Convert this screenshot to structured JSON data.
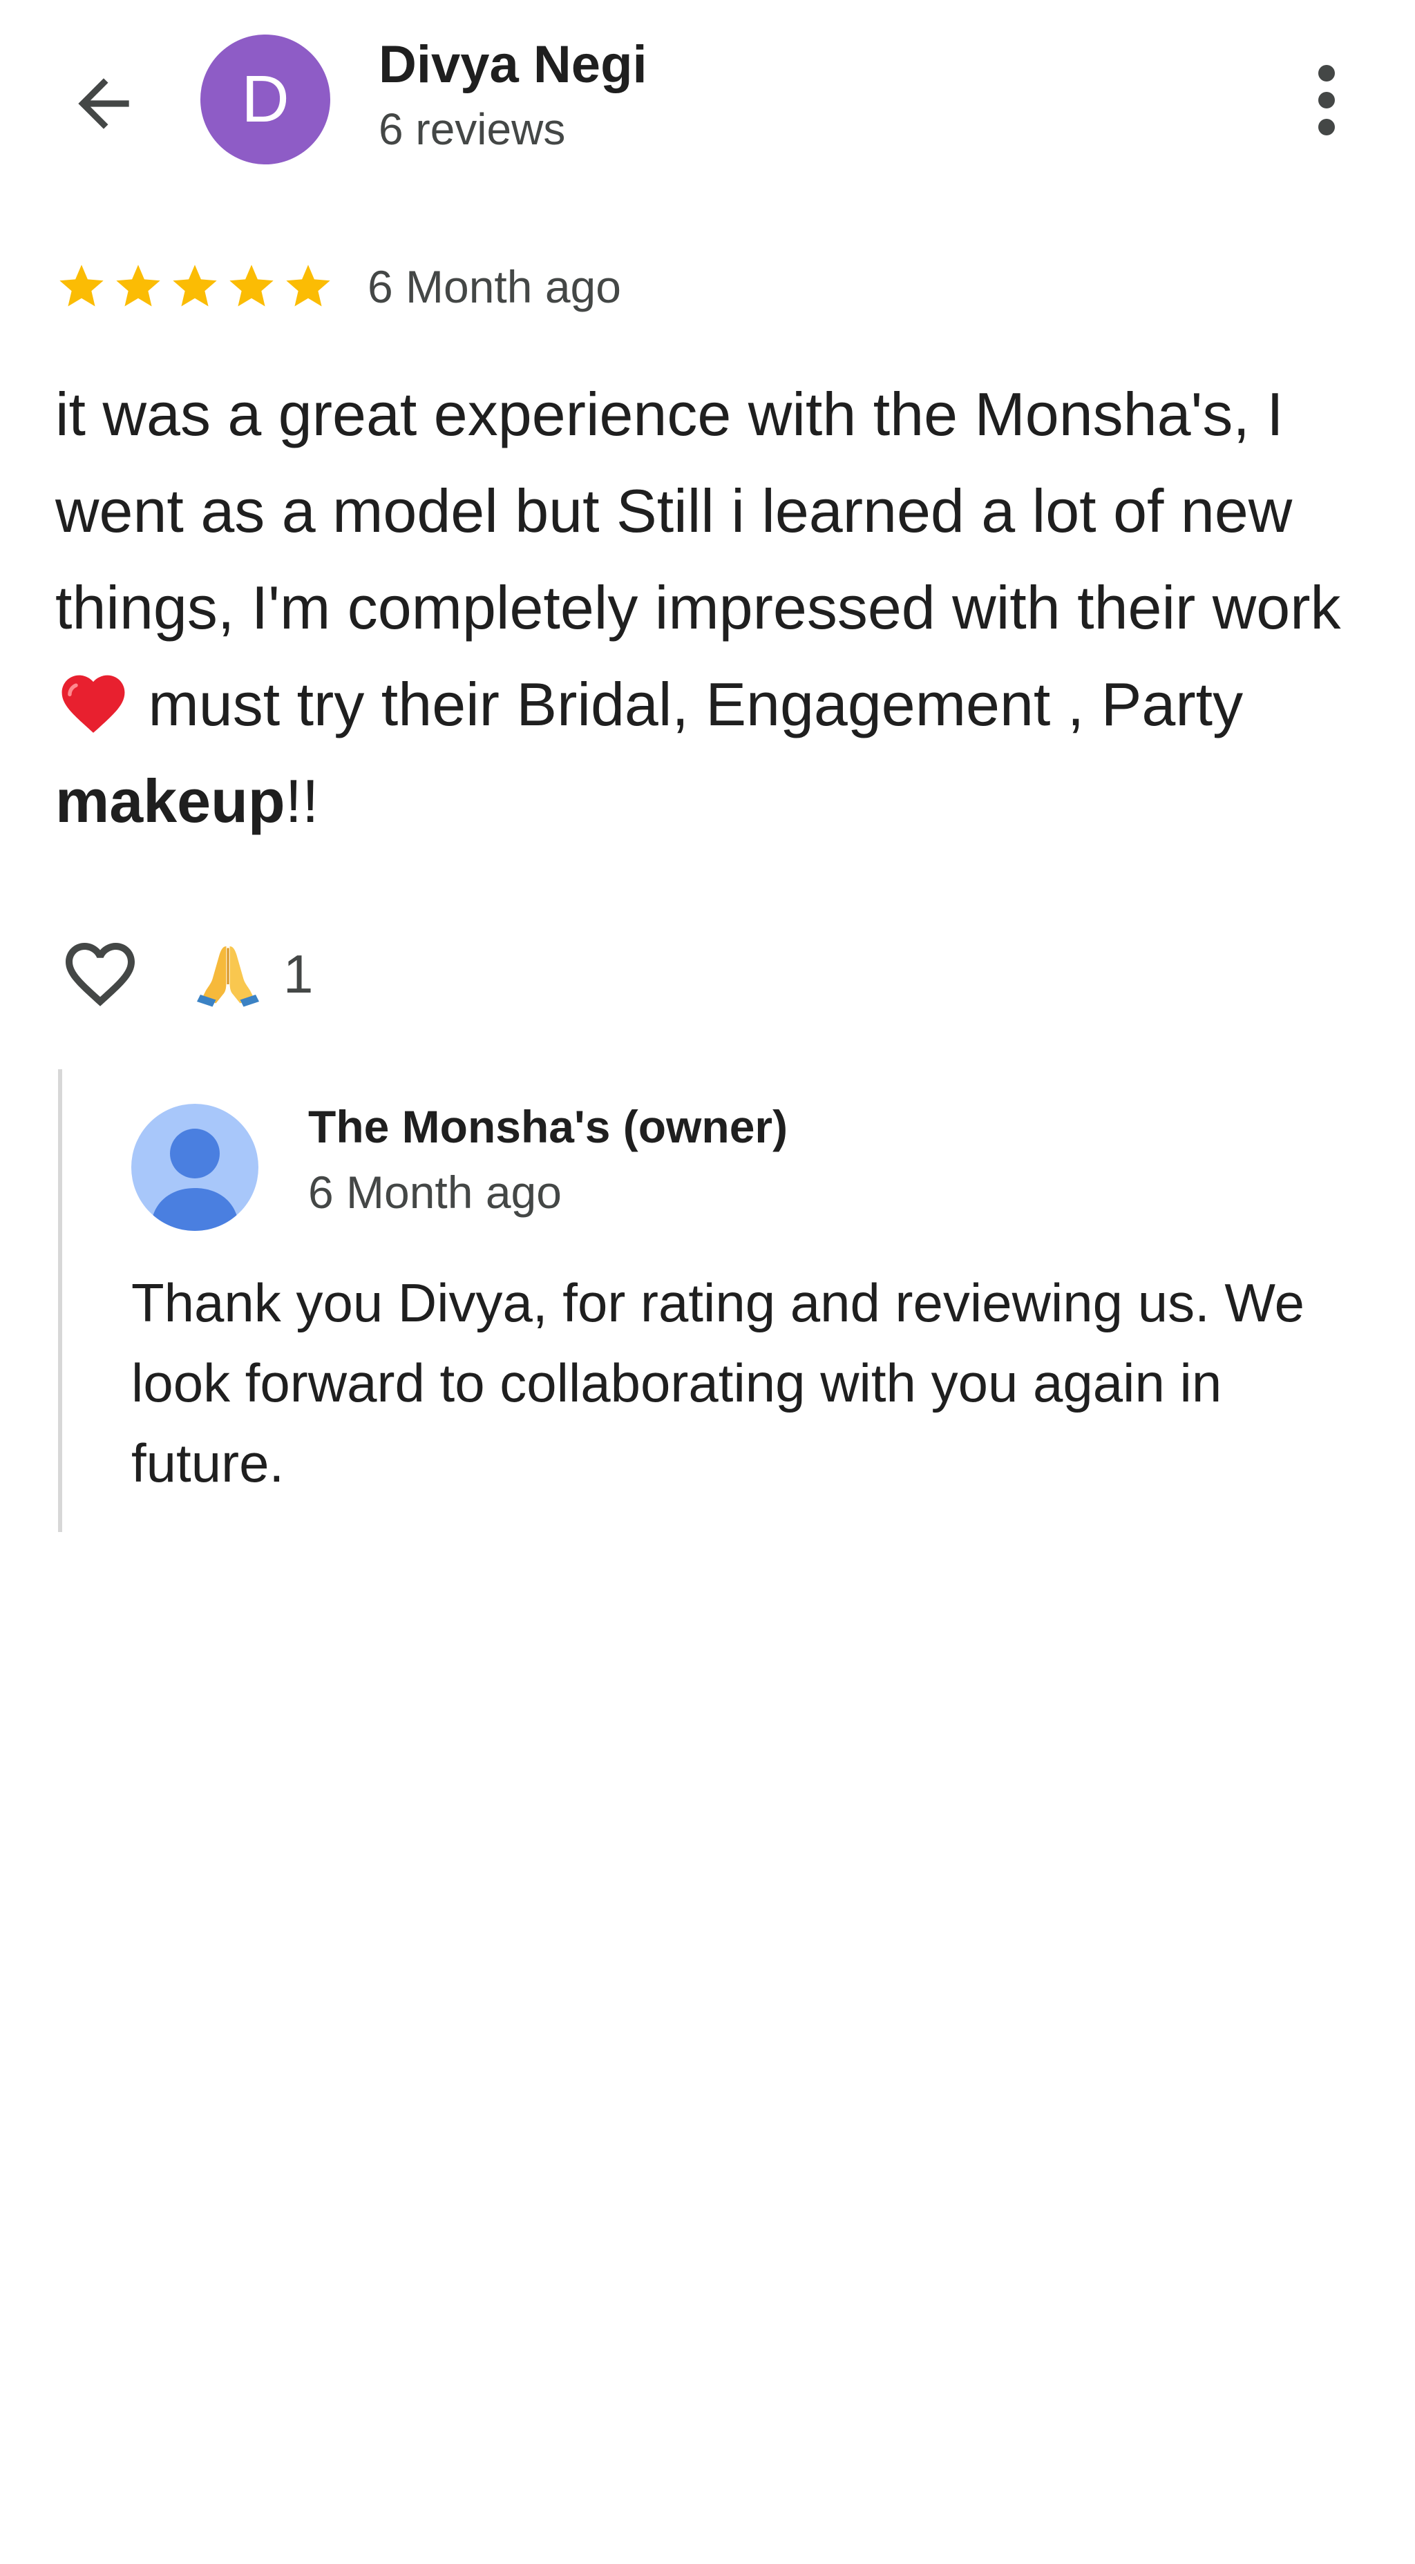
{
  "header": {
    "back_icon": "arrow-back-icon",
    "avatar_letter": "D",
    "avatar_color": "#8e5cc6",
    "reviewer_name": "Divya Negi",
    "review_count": "6 reviews",
    "more_icon": "more-vert-icon"
  },
  "review": {
    "rating": 5,
    "rating_max": 5,
    "star_color": "#fbbc04",
    "time": "6 Month ago",
    "text_part1": "it was a great experience with the Monsha's, I went as a model but Still i learned a lot of new things, I'm completely impressed with their work ",
    "text_emoji": "red-heart-emoji",
    "text_part2": " must try their Bridal, Engagement , Party ",
    "text_bold": "makeup",
    "text_part3": "!!"
  },
  "reactions": {
    "like_icon": "heart-outline-icon",
    "reaction_emoji": "folded-hands-emoji",
    "reaction_count": "1"
  },
  "owner_reply": {
    "avatar_icon": "person-icon",
    "name": "The Monsha's (owner)",
    "time": "6 Month ago",
    "text": "Thank you Divya, for rating and reviewing us. We look forward to collaborating with you again in future."
  }
}
